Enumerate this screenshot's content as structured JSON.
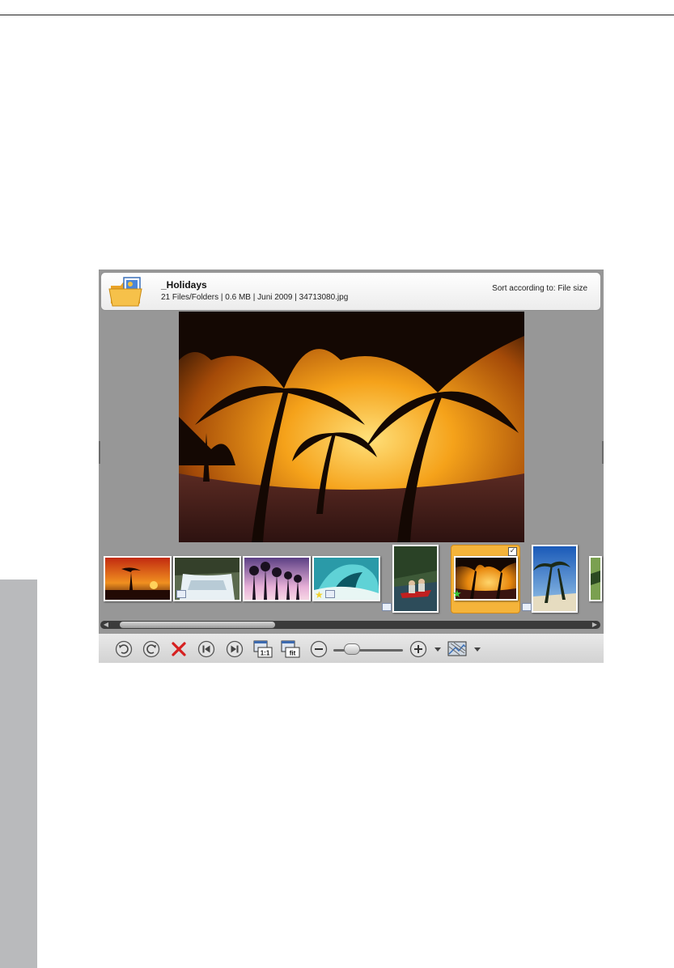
{
  "header": {
    "folder_name": "_Holidays",
    "info": "21 Files/Folders | 0.6 MB | Juni 2009 | 34713080.jpg",
    "sort_label": "Sort according to: File size"
  },
  "thumbnails": [
    {
      "subject": "palm sunset",
      "rating": null
    },
    {
      "subject": "waterfall",
      "rating": null
    },
    {
      "subject": "palm silhouettes purple sky",
      "rating": null
    },
    {
      "subject": "ocean wave",
      "rating": "star-yellow"
    },
    {
      "subject": "canoe in river",
      "rating": null
    },
    {
      "subject": "palm sunset",
      "rating": "star-green",
      "selected": true,
      "checked": true
    },
    {
      "subject": "palms on beach",
      "rating": null
    },
    {
      "subject": "palm",
      "rating": null
    }
  ],
  "toolbar": {
    "buttons": [
      "rotate-left-icon",
      "rotate-right-icon",
      "delete-icon",
      "previous-icon",
      "next-icon",
      "actual-size-icon",
      "fit-window-icon",
      "zoom-out-icon",
      "zoom-in-icon",
      "view-mode-icon"
    ],
    "actual_size_label": "1:1",
    "fit_label": "fit",
    "zoom_level": 0.2
  },
  "colors": {
    "accent_selection": "#f5b43a",
    "delete": "#d62020",
    "viewer_bg": "#979797"
  }
}
